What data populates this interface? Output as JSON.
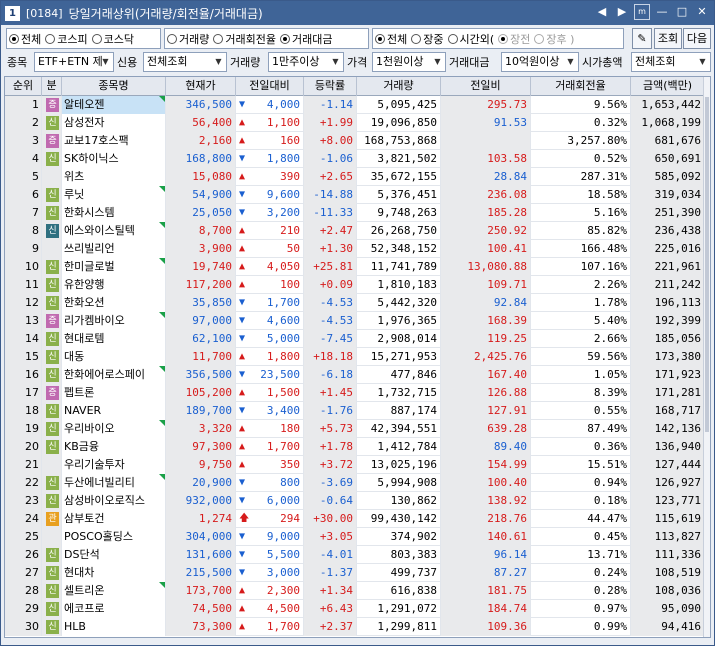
{
  "window": {
    "number": "1",
    "code": "[0184]",
    "title": "당일거래상위(거래량/회전율/거래대금)",
    "buttons": [
      "◀",
      "▶",
      "m",
      "—",
      "□",
      "✕"
    ]
  },
  "toolbar": {
    "market_radios": [
      {
        "label": "전체",
        "checked": true
      },
      {
        "label": "코스피",
        "checked": false
      },
      {
        "label": "코스닥",
        "checked": false
      }
    ],
    "type_radios": [
      {
        "label": "거래량",
        "checked": false
      },
      {
        "label": "거래회전율",
        "checked": false
      },
      {
        "label": "거래대금",
        "checked": true
      }
    ],
    "session_radios": [
      {
        "label": "전체",
        "checked": true
      },
      {
        "label": "장중",
        "checked": false
      },
      {
        "label": "시간외(",
        "checked": false
      },
      {
        "label": "장전",
        "checked": true,
        "disabled": true
      },
      {
        "label": "장후 )",
        "checked": false,
        "disabled": true
      }
    ],
    "btn_icon": "✎",
    "btn_search": "조회",
    "btn_next": "다음"
  },
  "filters": {
    "label_item": "종목",
    "item_value": "ETF+ETN 제",
    "label_credit": "신용",
    "credit_value": "전체조회",
    "label_volume": "거래량",
    "volume_value": "1만주이상",
    "label_price": "가격",
    "price_value": "1천원이상",
    "label_amount": "거래대금",
    "amount_value": "10억원이상",
    "label_cap": "시가총액",
    "cap_value": "전체조회"
  },
  "table": {
    "headers": [
      "순위",
      "분",
      "종목명",
      "현재가",
      "전일대비",
      "등락률",
      "거래량",
      "전일비",
      "거래회전율",
      "금액(백만)"
    ],
    "rows": [
      {
        "rank": "1",
        "mk": "증",
        "name": "알테오젠",
        "price": "346,500",
        "dir": "dn",
        "chg": "4,000",
        "rate": "-1.14",
        "vol": "5,095,425",
        "prev": "295.73",
        "pc": "up",
        "turn": "9.56%",
        "amt": "1,653,442",
        "tri": true,
        "sel": true
      },
      {
        "rank": "2",
        "mk": "신",
        "name": "삼성전자",
        "price": "56,400",
        "dir": "up",
        "chg": "1,100",
        "rate": "+1.99",
        "vol": "19,096,850",
        "prev": "91.53",
        "pc": "dn",
        "turn": "0.32%",
        "amt": "1,068,199",
        "tri": false
      },
      {
        "rank": "3",
        "mk": "증",
        "name": "교보17호스팩",
        "price": "2,160",
        "dir": "up",
        "chg": "160",
        "rate": "+8.00",
        "vol": "168,753,868",
        "prev": "",
        "pc": "flat",
        "turn": "3,257.80%",
        "amt": "681,676",
        "tri": false
      },
      {
        "rank": "4",
        "mk": "신",
        "name": "SK하이닉스",
        "price": "168,800",
        "dir": "dn",
        "chg": "1,800",
        "rate": "-1.06",
        "vol": "3,821,502",
        "prev": "103.58",
        "pc": "up",
        "turn": "0.52%",
        "amt": "650,691",
        "tri": false
      },
      {
        "rank": "5",
        "mk": "",
        "name": "위츠",
        "price": "15,080",
        "dir": "up",
        "chg": "390",
        "rate": "+2.65",
        "vol": "35,672,155",
        "prev": "28.84",
        "pc": "dn",
        "turn": "287.31%",
        "amt": "585,092",
        "tri": false
      },
      {
        "rank": "6",
        "mk": "신",
        "name": "루닛",
        "price": "54,900",
        "dir": "dn",
        "chg": "9,600",
        "rate": "-14.88",
        "vol": "5,376,451",
        "prev": "236.08",
        "pc": "up",
        "turn": "18.58%",
        "amt": "319,034",
        "tri": true
      },
      {
        "rank": "7",
        "mk": "신",
        "name": "한화시스템",
        "price": "25,050",
        "dir": "dn",
        "chg": "3,200",
        "rate": "-11.33",
        "vol": "9,748,263",
        "prev": "185.28",
        "pc": "up",
        "turn": "5.16%",
        "amt": "251,390",
        "tri": false
      },
      {
        "rank": "8",
        "mk": "신s",
        "name": "에스와이스틸텍",
        "price": "8,700",
        "dir": "up",
        "chg": "210",
        "rate": "+2.47",
        "vol": "26,268,750",
        "prev": "250.92",
        "pc": "up",
        "turn": "85.82%",
        "amt": "236,438",
        "tri": true
      },
      {
        "rank": "9",
        "mk": "",
        "name": "쓰리빌리언",
        "price": "3,900",
        "dir": "up",
        "chg": "50",
        "rate": "+1.30",
        "vol": "52,348,152",
        "prev": "100.41",
        "pc": "up",
        "turn": "166.48%",
        "amt": "225,016",
        "tri": false
      },
      {
        "rank": "10",
        "mk": "신",
        "name": "한미글로벌",
        "price": "19,740",
        "dir": "up",
        "chg": "4,050",
        "rate": "+25.81",
        "vol": "11,741,789",
        "prev": "13,080.88",
        "pc": "up",
        "turn": "107.16%",
        "amt": "221,961",
        "tri": true
      },
      {
        "rank": "11",
        "mk": "신",
        "name": "유한양행",
        "price": "117,200",
        "dir": "up",
        "chg": "100",
        "rate": "+0.09",
        "vol": "1,810,183",
        "prev": "109.71",
        "pc": "up",
        "turn": "2.26%",
        "amt": "211,242",
        "tri": false
      },
      {
        "rank": "12",
        "mk": "신",
        "name": "한화오션",
        "price": "35,850",
        "dir": "dn",
        "chg": "1,700",
        "rate": "-4.53",
        "vol": "5,442,320",
        "prev": "92.84",
        "pc": "dn",
        "turn": "1.78%",
        "amt": "196,113",
        "tri": false
      },
      {
        "rank": "13",
        "mk": "증",
        "name": "리가켐바이오",
        "price": "97,000",
        "dir": "dn",
        "chg": "4,600",
        "rate": "-4.53",
        "vol": "1,976,365",
        "prev": "168.39",
        "pc": "up",
        "turn": "5.40%",
        "amt": "192,399",
        "tri": true
      },
      {
        "rank": "14",
        "mk": "신",
        "name": "현대로템",
        "price": "62,100",
        "dir": "dn",
        "chg": "5,000",
        "rate": "-7.45",
        "vol": "2,908,014",
        "prev": "119.25",
        "pc": "up",
        "turn": "2.66%",
        "amt": "185,056",
        "tri": false
      },
      {
        "rank": "15",
        "mk": "신",
        "name": "대동",
        "price": "11,700",
        "dir": "up",
        "chg": "1,800",
        "rate": "+18.18",
        "vol": "15,271,953",
        "prev": "2,425.76",
        "pc": "up",
        "turn": "59.56%",
        "amt": "173,380",
        "tri": false
      },
      {
        "rank": "16",
        "mk": "신",
        "name": "한화에어로스페이",
        "price": "356,500",
        "dir": "dn",
        "chg": "23,500",
        "rate": "-6.18",
        "vol": "477,846",
        "prev": "167.40",
        "pc": "up",
        "turn": "1.05%",
        "amt": "171,923",
        "tri": true
      },
      {
        "rank": "17",
        "mk": "증",
        "name": "펩트론",
        "price": "105,200",
        "dir": "up",
        "chg": "1,500",
        "rate": "+1.45",
        "vol": "1,732,715",
        "prev": "126.88",
        "pc": "up",
        "turn": "8.39%",
        "amt": "171,281",
        "tri": false
      },
      {
        "rank": "18",
        "mk": "신",
        "name": "NAVER",
        "price": "189,700",
        "dir": "dn",
        "chg": "3,400",
        "rate": "-1.76",
        "vol": "887,174",
        "prev": "127.91",
        "pc": "up",
        "turn": "0.55%",
        "amt": "168,717",
        "tri": false
      },
      {
        "rank": "19",
        "mk": "신",
        "name": "우리바이오",
        "price": "3,320",
        "dir": "up",
        "chg": "180",
        "rate": "+5.73",
        "vol": "42,394,551",
        "prev": "639.28",
        "pc": "up",
        "turn": "87.49%",
        "amt": "142,136",
        "tri": true
      },
      {
        "rank": "20",
        "mk": "신",
        "name": "KB금융",
        "price": "97,300",
        "dir": "up",
        "chg": "1,700",
        "rate": "+1.78",
        "vol": "1,412,784",
        "prev": "89.40",
        "pc": "dn",
        "turn": "0.36%",
        "amt": "136,940",
        "tri": false
      },
      {
        "rank": "21",
        "mk": "",
        "name": "우리기술투자",
        "price": "9,750",
        "dir": "up",
        "chg": "350",
        "rate": "+3.72",
        "vol": "13,025,196",
        "prev": "154.99",
        "pc": "up",
        "turn": "15.51%",
        "amt": "127,444",
        "tri": false
      },
      {
        "rank": "22",
        "mk": "신",
        "name": "두산에너빌리티",
        "price": "20,900",
        "dir": "dn",
        "chg": "800",
        "rate": "-3.69",
        "vol": "5,994,908",
        "prev": "100.40",
        "pc": "up",
        "turn": "0.94%",
        "amt": "126,927",
        "tri": true
      },
      {
        "rank": "23",
        "mk": "신",
        "name": "삼성바이오로직스",
        "price": "932,000",
        "dir": "dn",
        "chg": "6,000",
        "rate": "-0.64",
        "vol": "130,862",
        "prev": "138.92",
        "pc": "up",
        "turn": "0.18%",
        "amt": "123,771",
        "tri": false
      },
      {
        "rank": "24",
        "mk": "관",
        "name": "삼부토건",
        "price": "1,274",
        "dir": "upx",
        "chg": "294",
        "rate": "+30.00",
        "vol": "99,430,142",
        "prev": "218.76",
        "pc": "up",
        "turn": "44.47%",
        "amt": "115,619",
        "tri": false
      },
      {
        "rank": "25",
        "mk": "",
        "name": "POSCO홀딩스",
        "price": "304,000",
        "dir": "dn",
        "chg": "9,000",
        "rate": "+3.05",
        "vol": "374,902",
        "prev": "140.61",
        "pc": "up",
        "turn": "0.45%",
        "amt": "113,827",
        "tri": false
      },
      {
        "rank": "26",
        "mk": "신",
        "name": "DS단석",
        "price": "131,600",
        "dir": "dn",
        "chg": "5,500",
        "rate": "-4.01",
        "vol": "803,383",
        "prev": "96.14",
        "pc": "dn",
        "turn": "13.71%",
        "amt": "111,336",
        "tri": false
      },
      {
        "rank": "27",
        "mk": "신",
        "name": "현대차",
        "price": "215,500",
        "dir": "dn",
        "chg": "3,000",
        "rate": "-1.37",
        "vol": "499,737",
        "prev": "87.27",
        "pc": "dn",
        "turn": "0.24%",
        "amt": "108,519",
        "tri": false
      },
      {
        "rank": "28",
        "mk": "신",
        "name": "셀트리온",
        "price": "173,700",
        "dir": "up",
        "chg": "2,300",
        "rate": "+1.34",
        "vol": "616,838",
        "prev": "181.75",
        "pc": "up",
        "turn": "0.28%",
        "amt": "108,036",
        "tri": true
      },
      {
        "rank": "29",
        "mk": "신",
        "name": "에코프로",
        "price": "74,500",
        "dir": "up",
        "chg": "4,500",
        "rate": "+6.43",
        "vol": "1,291,072",
        "prev": "184.74",
        "pc": "up",
        "turn": "0.97%",
        "amt": "95,090",
        "tri": false
      },
      {
        "rank": "30",
        "mk": "신",
        "name": "HLB",
        "price": "73,300",
        "dir": "up",
        "chg": "1,700",
        "rate": "+2.37",
        "vol": "1,299,811",
        "prev": "109.36",
        "pc": "up",
        "turn": "0.99%",
        "amt": "94,416",
        "tri": false
      }
    ]
  },
  "colors": {
    "up": "#d61b1b",
    "down": "#1a5fd0",
    "title_bg": "#3f6497"
  }
}
